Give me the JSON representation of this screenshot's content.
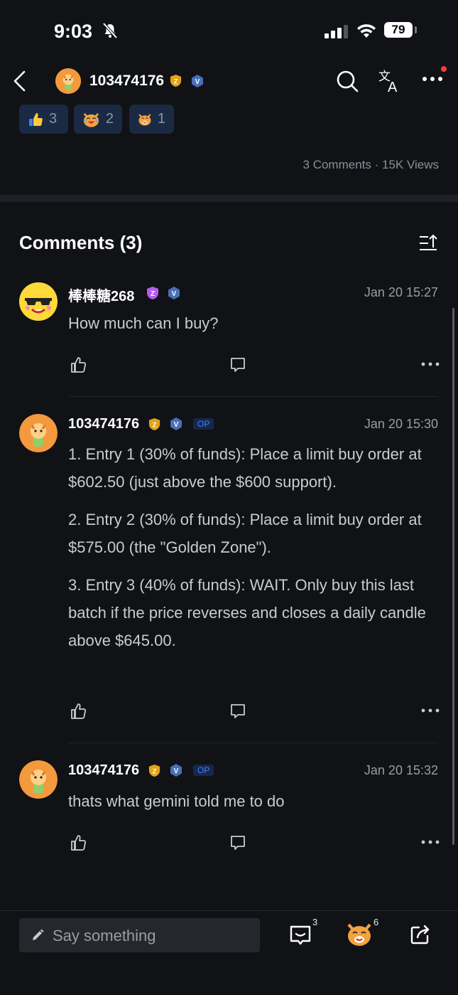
{
  "status_bar": {
    "time": "9:03",
    "battery": "79"
  },
  "header": {
    "username": "103474176"
  },
  "reactions": [
    {
      "icon": "thumbs-up-icon",
      "count": "3"
    },
    {
      "icon": "laughing-cat-icon",
      "count": "2"
    },
    {
      "icon": "tiger-face-icon",
      "count": "1"
    }
  ],
  "post_meta": "3 Comments · 15K Views",
  "comments_title": "Comments (3)",
  "comments": [
    {
      "username": "棒棒糖268",
      "date": "Jan 20 15:27",
      "text": [
        "How much can I buy?"
      ]
    },
    {
      "username": "103474176",
      "op_label": "OP",
      "date": "Jan 20 15:30",
      "text": [
        "1. Entry 1 (30% of funds): Place a limit buy order at $602.50 (just above the $600 support).",
        "2. Entry 2 (30% of funds): Place a limit buy order at $575.00 (the \"Golden Zone\").",
        "3. Entry 3 (40% of funds): WAIT. Only buy this last batch if the price reverses and closes a daily candle above $645.00."
      ]
    },
    {
      "username": "103474176",
      "op_label": "OP",
      "date": "Jan 20 15:32",
      "text": [
        "thats what gemini told me to do"
      ]
    }
  ],
  "bottom_bar": {
    "input_placeholder": "Say something",
    "comment_count": "3",
    "reaction_count": "6"
  },
  "colors": {
    "background": "#111216",
    "accent_blue": "#3e80ff",
    "reaction_bg": "#1a2a44"
  }
}
